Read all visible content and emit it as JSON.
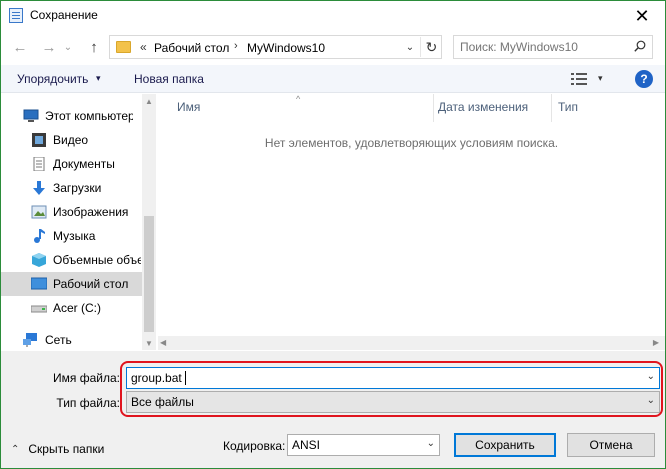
{
  "window": {
    "title": "Сохранение",
    "close_glyph": "✕"
  },
  "nav": {
    "back_glyph": "←",
    "forward_glyph": "→",
    "recent_glyph": "⌄",
    "up_glyph": "↑",
    "address": {
      "overflow_glyph": "«",
      "crumbs": [
        "Рабочий стол",
        "MyWindows10"
      ],
      "separator": "›",
      "dropdown_glyph": "⌄",
      "refresh_glyph": "↻"
    },
    "search": {
      "placeholder": "Поиск: MyWindows10"
    }
  },
  "toolbar": {
    "organize_label": "Упорядочить",
    "organize_arrow": "▾",
    "new_folder_label": "Новая папка",
    "view_arrow": "▾",
    "help_glyph": "?"
  },
  "sidebar": {
    "items": [
      {
        "label": "Этот компьютер",
        "icon": "computer-icon"
      },
      {
        "label": "Видео",
        "icon": "video-icon"
      },
      {
        "label": "Документы",
        "icon": "documents-icon"
      },
      {
        "label": "Загрузки",
        "icon": "downloads-icon"
      },
      {
        "label": "Изображения",
        "icon": "pictures-icon"
      },
      {
        "label": "Музыка",
        "icon": "music-icon"
      },
      {
        "label": "Объемные объекты",
        "icon": "3d-objects-icon"
      },
      {
        "label": "Рабочий стол",
        "icon": "desktop-icon",
        "selected": true
      },
      {
        "label": "Acer (C:)",
        "icon": "drive-icon"
      },
      {
        "label": "Сеть",
        "icon": "network-icon"
      }
    ],
    "scroll_up_glyph": "▲",
    "scroll_down_glyph": "▼"
  },
  "main": {
    "columns": [
      "Имя",
      "Дата изменения",
      "Тип"
    ],
    "sort_glyph": "^",
    "empty_message": "Нет элементов, удовлетворяющих условиям поиска.",
    "scroll_left_glyph": "◀",
    "scroll_right_glyph": "▶"
  },
  "form": {
    "filename_label": "Имя файла:",
    "filename_value": "group.bat",
    "filetype_label": "Тип файла:",
    "filetype_value": "Все файлы",
    "dropdown_glyph": "⌄",
    "encoding_label": "Кодировка:",
    "encoding_value": "ANSI"
  },
  "footer": {
    "hide_folders_arrow": "⌃",
    "hide_folders_label": "Скрыть папки",
    "save_label": "Сохранить",
    "cancel_label": "Отмена"
  },
  "colors": {
    "accent": "#0078d7",
    "highlight": "#e0141e",
    "help": "#1f63c6"
  }
}
